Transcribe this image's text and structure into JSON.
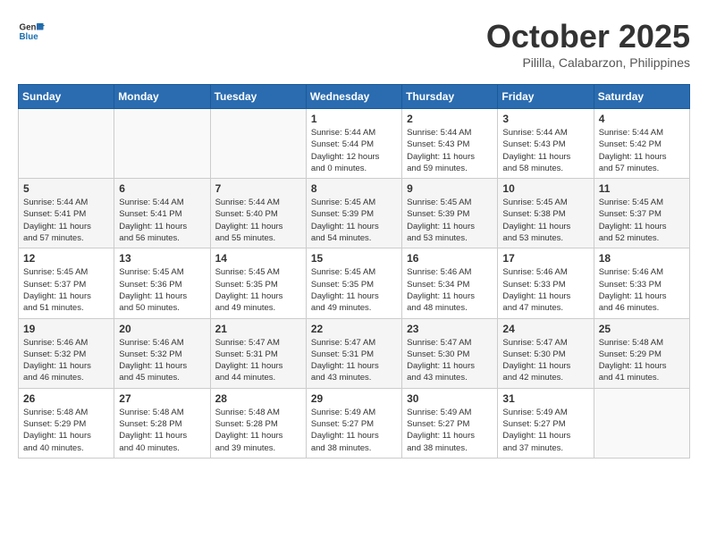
{
  "header": {
    "logo_general": "General",
    "logo_blue": "Blue",
    "month_title": "October 2025",
    "location": "Pililla, Calabarzon, Philippines"
  },
  "calendar": {
    "days_of_week": [
      "Sunday",
      "Monday",
      "Tuesday",
      "Wednesday",
      "Thursday",
      "Friday",
      "Saturday"
    ],
    "weeks": [
      [
        {
          "day": "",
          "info": ""
        },
        {
          "day": "",
          "info": ""
        },
        {
          "day": "",
          "info": ""
        },
        {
          "day": "1",
          "info": "Sunrise: 5:44 AM\nSunset: 5:44 PM\nDaylight: 12 hours\nand 0 minutes."
        },
        {
          "day": "2",
          "info": "Sunrise: 5:44 AM\nSunset: 5:43 PM\nDaylight: 11 hours\nand 59 minutes."
        },
        {
          "day": "3",
          "info": "Sunrise: 5:44 AM\nSunset: 5:43 PM\nDaylight: 11 hours\nand 58 minutes."
        },
        {
          "day": "4",
          "info": "Sunrise: 5:44 AM\nSunset: 5:42 PM\nDaylight: 11 hours\nand 57 minutes."
        }
      ],
      [
        {
          "day": "5",
          "info": "Sunrise: 5:44 AM\nSunset: 5:41 PM\nDaylight: 11 hours\nand 57 minutes."
        },
        {
          "day": "6",
          "info": "Sunrise: 5:44 AM\nSunset: 5:41 PM\nDaylight: 11 hours\nand 56 minutes."
        },
        {
          "day": "7",
          "info": "Sunrise: 5:44 AM\nSunset: 5:40 PM\nDaylight: 11 hours\nand 55 minutes."
        },
        {
          "day": "8",
          "info": "Sunrise: 5:45 AM\nSunset: 5:39 PM\nDaylight: 11 hours\nand 54 minutes."
        },
        {
          "day": "9",
          "info": "Sunrise: 5:45 AM\nSunset: 5:39 PM\nDaylight: 11 hours\nand 53 minutes."
        },
        {
          "day": "10",
          "info": "Sunrise: 5:45 AM\nSunset: 5:38 PM\nDaylight: 11 hours\nand 53 minutes."
        },
        {
          "day": "11",
          "info": "Sunrise: 5:45 AM\nSunset: 5:37 PM\nDaylight: 11 hours\nand 52 minutes."
        }
      ],
      [
        {
          "day": "12",
          "info": "Sunrise: 5:45 AM\nSunset: 5:37 PM\nDaylight: 11 hours\nand 51 minutes."
        },
        {
          "day": "13",
          "info": "Sunrise: 5:45 AM\nSunset: 5:36 PM\nDaylight: 11 hours\nand 50 minutes."
        },
        {
          "day": "14",
          "info": "Sunrise: 5:45 AM\nSunset: 5:35 PM\nDaylight: 11 hours\nand 49 minutes."
        },
        {
          "day": "15",
          "info": "Sunrise: 5:45 AM\nSunset: 5:35 PM\nDaylight: 11 hours\nand 49 minutes."
        },
        {
          "day": "16",
          "info": "Sunrise: 5:46 AM\nSunset: 5:34 PM\nDaylight: 11 hours\nand 48 minutes."
        },
        {
          "day": "17",
          "info": "Sunrise: 5:46 AM\nSunset: 5:33 PM\nDaylight: 11 hours\nand 47 minutes."
        },
        {
          "day": "18",
          "info": "Sunrise: 5:46 AM\nSunset: 5:33 PM\nDaylight: 11 hours\nand 46 minutes."
        }
      ],
      [
        {
          "day": "19",
          "info": "Sunrise: 5:46 AM\nSunset: 5:32 PM\nDaylight: 11 hours\nand 46 minutes."
        },
        {
          "day": "20",
          "info": "Sunrise: 5:46 AM\nSunset: 5:32 PM\nDaylight: 11 hours\nand 45 minutes."
        },
        {
          "day": "21",
          "info": "Sunrise: 5:47 AM\nSunset: 5:31 PM\nDaylight: 11 hours\nand 44 minutes."
        },
        {
          "day": "22",
          "info": "Sunrise: 5:47 AM\nSunset: 5:31 PM\nDaylight: 11 hours\nand 43 minutes."
        },
        {
          "day": "23",
          "info": "Sunrise: 5:47 AM\nSunset: 5:30 PM\nDaylight: 11 hours\nand 43 minutes."
        },
        {
          "day": "24",
          "info": "Sunrise: 5:47 AM\nSunset: 5:30 PM\nDaylight: 11 hours\nand 42 minutes."
        },
        {
          "day": "25",
          "info": "Sunrise: 5:48 AM\nSunset: 5:29 PM\nDaylight: 11 hours\nand 41 minutes."
        }
      ],
      [
        {
          "day": "26",
          "info": "Sunrise: 5:48 AM\nSunset: 5:29 PM\nDaylight: 11 hours\nand 40 minutes."
        },
        {
          "day": "27",
          "info": "Sunrise: 5:48 AM\nSunset: 5:28 PM\nDaylight: 11 hours\nand 40 minutes."
        },
        {
          "day": "28",
          "info": "Sunrise: 5:48 AM\nSunset: 5:28 PM\nDaylight: 11 hours\nand 39 minutes."
        },
        {
          "day": "29",
          "info": "Sunrise: 5:49 AM\nSunset: 5:27 PM\nDaylight: 11 hours\nand 38 minutes."
        },
        {
          "day": "30",
          "info": "Sunrise: 5:49 AM\nSunset: 5:27 PM\nDaylight: 11 hours\nand 38 minutes."
        },
        {
          "day": "31",
          "info": "Sunrise: 5:49 AM\nSunset: 5:27 PM\nDaylight: 11 hours\nand 37 minutes."
        },
        {
          "day": "",
          "info": ""
        }
      ]
    ]
  }
}
